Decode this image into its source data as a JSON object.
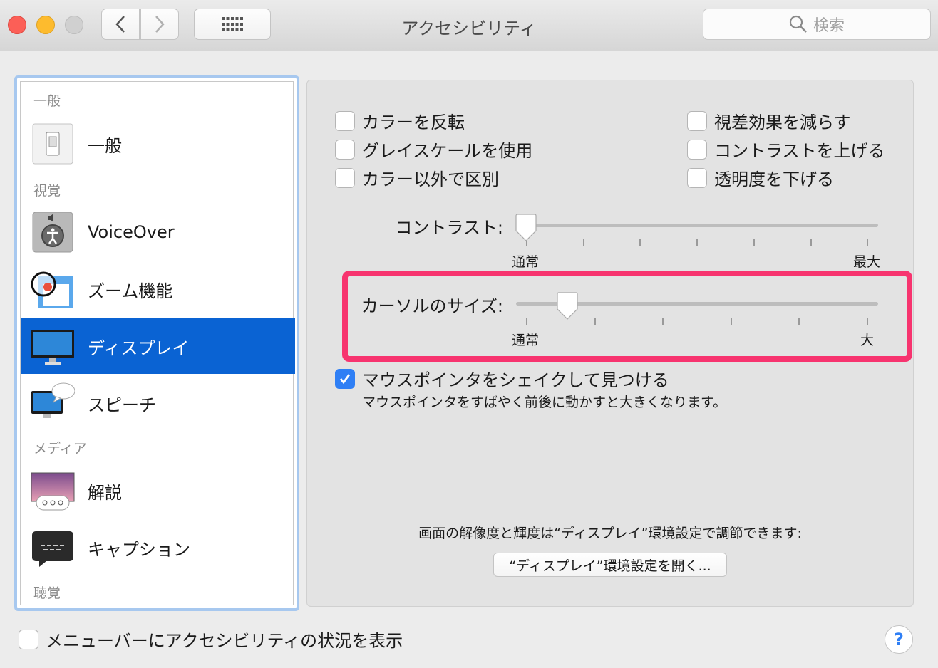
{
  "window": {
    "title": "アクセシビリティ"
  },
  "toolbar": {
    "search_placeholder": "検索"
  },
  "sidebar": {
    "sections": [
      "一般",
      "視覚",
      "メディア",
      "聴覚"
    ],
    "items": [
      {
        "label": "一般",
        "icon": "general-icon"
      },
      {
        "label": "VoiceOver",
        "icon": "voiceover-icon"
      },
      {
        "label": "ズーム機能",
        "icon": "zoom-icon"
      },
      {
        "label": "ディスプレイ",
        "icon": "display-icon",
        "selected": true
      },
      {
        "label": "スピーチ",
        "icon": "speech-icon"
      },
      {
        "label": "解説",
        "icon": "descriptions-icon"
      },
      {
        "label": "キャプション",
        "icon": "captions-icon"
      }
    ]
  },
  "options": {
    "invert_colors": "カラーを反転",
    "grayscale": "グレイスケールを使用",
    "differentiate": "カラー以外で区別",
    "reduce_motion": "視差効果を減らす",
    "increase_contrast": "コントラストを上げる",
    "reduce_transparency": "透明度を下げる"
  },
  "contrast_slider": {
    "label": "コントラスト:",
    "min_label": "通常",
    "max_label": "最大",
    "value": 0.0
  },
  "cursor_slider": {
    "label": "カーソルのサイズ:",
    "min_label": "通常",
    "max_label": "大",
    "value": 0.12
  },
  "shake": {
    "label": "マウスポインタをシェイクして見つける",
    "description": "マウスポインタをすばやく前後に動かすと大きくなります。",
    "checked": true
  },
  "display_note": "画面の解像度と輝度は“ディスプレイ”環境設定で調節できます:",
  "open_display_button": "“ディスプレイ”環境設定を開く...",
  "menubar_option": "メニューバーにアクセシビリティの状況を表示",
  "help": "?",
  "colors": {
    "accent": "#0a63d3",
    "highlight": "#f7346f"
  }
}
